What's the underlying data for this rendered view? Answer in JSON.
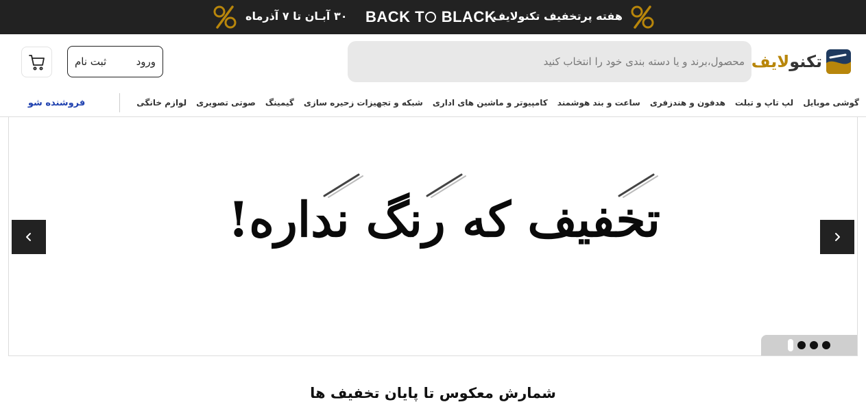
{
  "promo": {
    "week_text": "هفته پرتخفیف تکنولایف",
    "brand_pre": "BACK T",
    "brand_post": " BLACK",
    "dates_text": "۳۰ آبـان تا ۷ آذرماه",
    "icon": "percent-icon"
  },
  "header": {
    "logo_main": "تکنو",
    "logo_accent": "لایف",
    "search_placeholder": "محصول،برند و یا دسته بندی خود را انتخاب کنید",
    "login_label": "ورود",
    "signup_label": "ثبت نام",
    "cart_icon": "cart-icon"
  },
  "nav": {
    "items": [
      "گوشی موبایل",
      "لپ تاپ و تبلت",
      "هدفون و هندزفری",
      "ساعت و بند هوشمند",
      "کامپیوتر و ماشین های اداری",
      "شبکه و تجهیزات زحیره سازی",
      "گیمینگ",
      "صوتی تصویری",
      "لوازم خانگی"
    ],
    "seller_label": "فروشنده شو"
  },
  "banner": {
    "headline": "تخفیف که رنگ نداره!",
    "slide_count": 4,
    "active_slide": 0,
    "colors": {
      "arrow_bg": "#222222",
      "dots_bg": "#cfcfcf"
    }
  },
  "countdown": {
    "title": "شمارش معکوس تا پایان تخفیف ها"
  },
  "colors": {
    "promo_bg": "#222222",
    "accent_gold": "#b8860b",
    "seller_blue": "#1e40af",
    "search_bg": "#e8e8e8"
  }
}
